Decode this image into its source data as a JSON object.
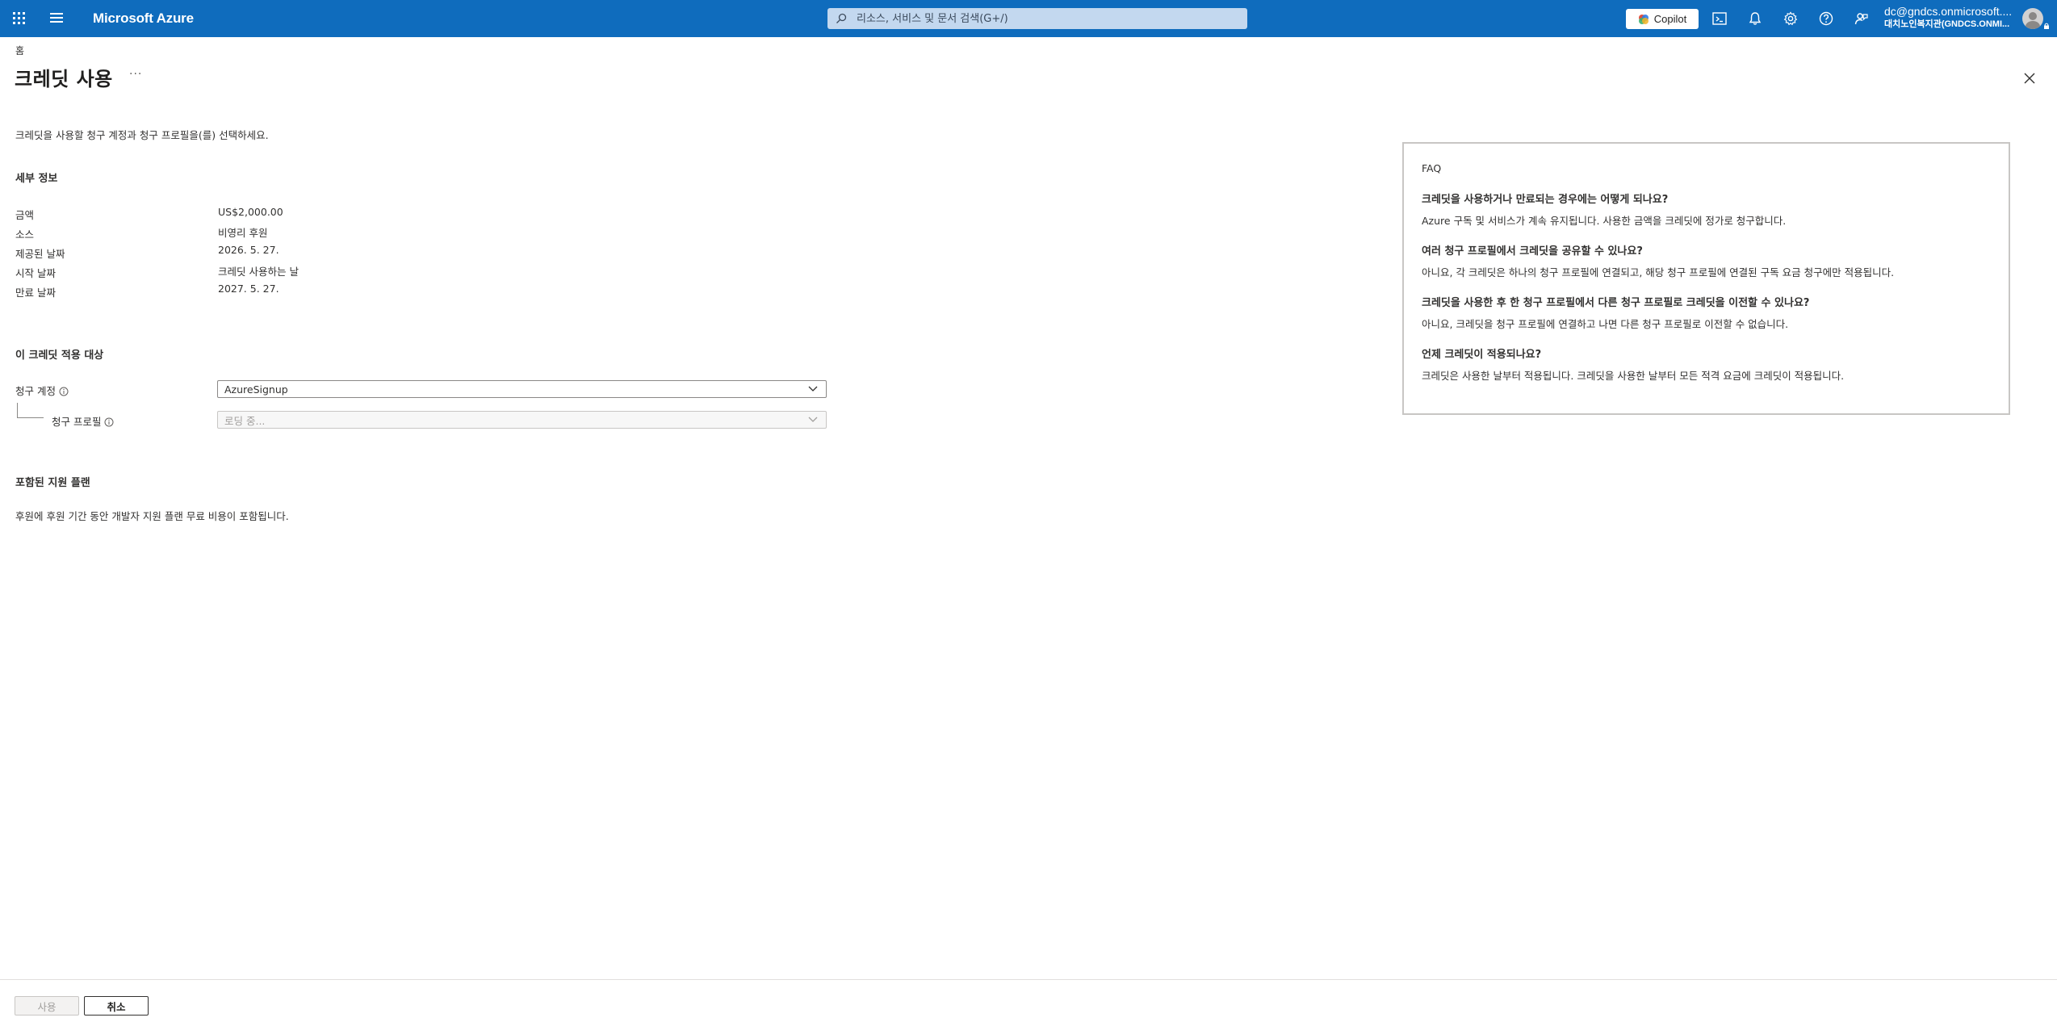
{
  "topbar": {
    "brand": "Microsoft Azure",
    "search_placeholder": "리소스, 서비스 및 문서 검색(G+/)",
    "copilot_label": "Copilot",
    "account_email": "dc@gndcs.onmicrosoft....",
    "account_directory": "대치노인복지관(GNDCS.ONMI..."
  },
  "breadcrumb": "홈",
  "page": {
    "title": "크레딧 사용",
    "more": "···",
    "intro": "크레딧을 사용할 청구 계정과 청구 프로필을(를) 선택하세요."
  },
  "details": {
    "heading": "세부 정보",
    "rows": [
      {
        "label": "금액",
        "value": "US$2,000.00"
      },
      {
        "label": "소스",
        "value": "비영리 후원"
      },
      {
        "label": "제공된 날짜",
        "value": "2026. 5. 27."
      },
      {
        "label": "시작 날짜",
        "value": "크레딧 사용하는 날"
      },
      {
        "label": "만료 날짜",
        "value": "2027. 5. 27."
      }
    ]
  },
  "applies": {
    "heading": "이 크레딧 적용 대상",
    "billing_account_label": "청구 계정",
    "billing_account_value": "AzureSignup",
    "billing_profile_label": "청구 프로필",
    "billing_profile_value": "로딩 중..."
  },
  "support": {
    "heading": "포함된 지원 플랜",
    "text": "후원에 후원 기간 동안 개발자 지원 플랜 무료 비용이 포함됩니다."
  },
  "faq": {
    "title": "FAQ",
    "items": [
      {
        "q": "크레딧을 사용하거나 만료되는 경우에는 어떻게 되나요?",
        "a": "Azure 구독 및 서비스가 계속 유지됩니다. 사용한 금액을 크레딧에 정가로 청구합니다."
      },
      {
        "q": "여러 청구 프로필에서 크레딧을 공유할 수 있나요?",
        "a": "아니요, 각 크레딧은 하나의 청구 프로필에 연결되고, 해당 청구 프로필에 연결된 구독 요금 청구에만 적용됩니다."
      },
      {
        "q": "크레딧을 사용한 후 한 청구 프로필에서 다른 청구 프로필로 크레딧을 이전할 수 있나요?",
        "a": "아니요, 크레딧을 청구 프로필에 연결하고 나면 다른 청구 프로필로 이전할 수 없습니다."
      },
      {
        "q": "언제 크레딧이 적용되나요?",
        "a": "크레딧은 사용한 날부터 적용됩니다. 크레딧을 사용한 날부터 모든 적격 요금에 크레딧이 적용됩니다."
      }
    ]
  },
  "footer": {
    "use_button": "사용",
    "cancel_button": "취소"
  },
  "colors": {
    "topbar": "#0f6cbd",
    "search_bg": "#c3d8ef"
  }
}
